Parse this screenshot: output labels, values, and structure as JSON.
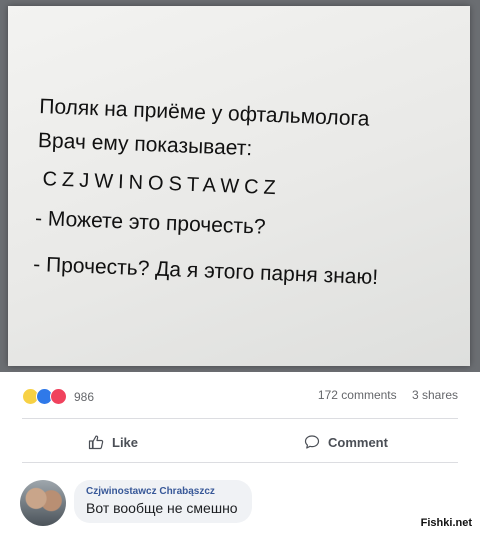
{
  "card": {
    "line1": "Поляк на приёме у офтальмолога",
    "line2": "Врач ему показывает:",
    "line3": "CZJWINOSTAWCZ",
    "line4": "- Можете это прочесть?",
    "line5": "- Прочесть? Да я этого парня знаю!"
  },
  "post": {
    "reaction_count": "986",
    "comments": "172 comments",
    "shares": "3 shares",
    "like_label": "Like",
    "comment_label": "Comment"
  },
  "comment": {
    "author": "Czjwinostawcz Chrabąszcz",
    "text": "Вот вообще не смешно"
  },
  "watermark": "Fishki.net",
  "colors": {
    "link": "#385898",
    "like_blue": "#2f79e9",
    "love_red": "#f0425d",
    "haha_yellow": "#f7d145"
  }
}
